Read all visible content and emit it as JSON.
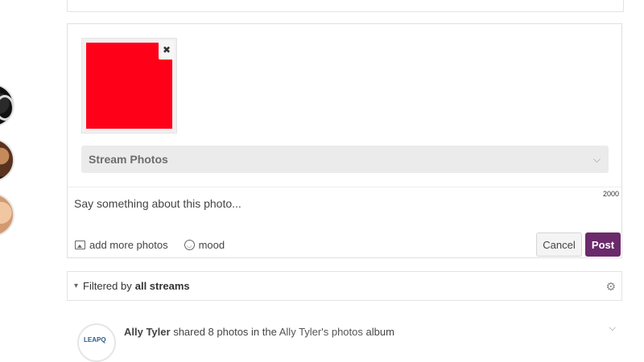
{
  "composer": {
    "remove_icon_glyph": "✖",
    "album_select": {
      "selected": "Stream Photos"
    },
    "char_limit": "2000",
    "caption_placeholder": "Say something about this photo...",
    "tools": {
      "add_photos_label": "add more photos",
      "mood_label": "mood"
    },
    "cancel_label": "Cancel",
    "post_label": "Post",
    "colors": {
      "post_button": "#6b2a6b",
      "thumbnail": "#ff0019"
    }
  },
  "filter": {
    "prefix": "Filtered by",
    "value": "all streams"
  },
  "feed": {
    "items": [
      {
        "avatar_text": "LEAPQ",
        "author": "Ally Tyler",
        "action": "shared 8 photos in the",
        "album": "Ally Tyler's photos",
        "suffix": "album"
      }
    ]
  }
}
